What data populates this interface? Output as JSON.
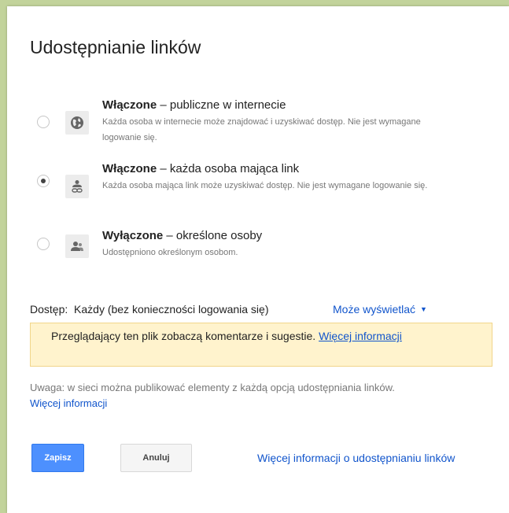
{
  "dialog": {
    "title": "Udostępnianie linków",
    "options": [
      {
        "title_bold": "Włączone",
        "title_rest": " – publiczne w internecie",
        "description": "Każda osoba w internecie może znajdować i uzyskiwać dostęp. Nie jest wymagane logowanie się.",
        "icon": "globe-icon",
        "selected": false
      },
      {
        "title_bold": "Włączone",
        "title_rest": " – każda osoba mająca link",
        "description": "Każda osoba mająca link może uzyskiwać dostęp. Nie jest wymagane logowanie się.",
        "icon": "person-link-icon",
        "selected": true
      },
      {
        "title_bold": "Wyłączone",
        "title_rest": " – określone osoby",
        "description": "Udostępniono określonym osobom.",
        "icon": "people-icon",
        "selected": false
      }
    ],
    "access": {
      "label": "Dostęp:  Każdy (bez konieczności logowania się)",
      "dropdown_value": "Może wyświetlać"
    },
    "notice": {
      "text": "Przeglądający ten plik zobaczą komentarze i sugestie. ",
      "link": "Więcej informacji"
    },
    "note": {
      "text": "Uwaga: w sieci można publikować elementy z każdą opcją udostępniania linków.",
      "link": "Więcej informacji"
    },
    "buttons": {
      "save": "Zapisz",
      "cancel": "Anuluj"
    },
    "footer_link": "Więcej informacji o udostępnianiu linków"
  },
  "colors": {
    "background": "#c2d39b",
    "link": "#1155cc",
    "primary_button": "#4d90fe",
    "notice_bg": "#fff3cd"
  }
}
